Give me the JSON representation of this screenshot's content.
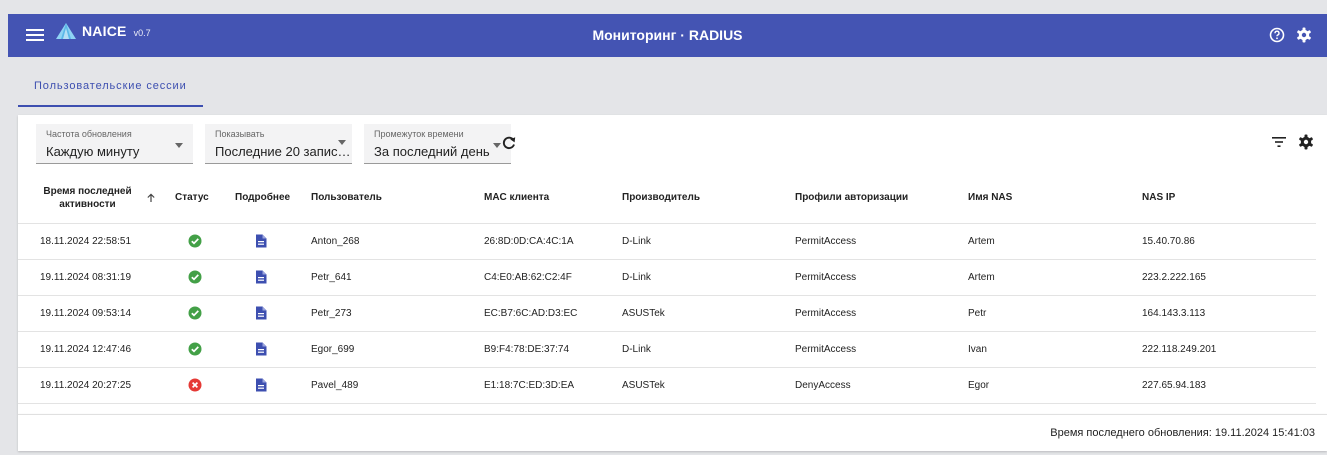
{
  "header": {
    "logo_name": "NAICE",
    "logo_version": "v0.7",
    "title": "Мониторинг · RADIUS",
    "accent_color": "#4454b3"
  },
  "tabs": [
    {
      "label": "Пользовательские сессии",
      "active": true
    }
  ],
  "controls": {
    "refresh_rate": {
      "label": "Частота обновления",
      "value": "Каждую минуту"
    },
    "show": {
      "label": "Показывать",
      "value": "Последние 20 запис…"
    },
    "time_range": {
      "label": "Промежуток времени",
      "value": "За последний день"
    }
  },
  "table": {
    "columns": [
      "Время последней активности",
      "Статус",
      "Подробнее",
      "Пользователь",
      "MAC клиента",
      "Производитель",
      "Профили авторизации",
      "Имя NAS",
      "NAS IP"
    ],
    "sort_column": "Время последней активности",
    "sort_direction": "ascending",
    "rows": [
      {
        "time": "18.11.2024 22:58:51",
        "status": "success",
        "user": "Anton_268",
        "mac": "26:8D:0D:CA:4C:1A",
        "vendor": "D-Link",
        "profile": "PermitAccess",
        "nas_name": "Artem",
        "nas_ip": "15.40.70.86"
      },
      {
        "time": "19.11.2024 08:31:19",
        "status": "success",
        "user": "Petr_641",
        "mac": "C4:E0:AB:62:C2:4F",
        "vendor": "D-Link",
        "profile": "PermitAccess",
        "nas_name": "Artem",
        "nas_ip": "223.2.222.165"
      },
      {
        "time": "19.11.2024 09:53:14",
        "status": "success",
        "user": "Petr_273",
        "mac": "EC:B7:6C:AD:D3:EC",
        "vendor": "ASUSTek",
        "profile": "PermitAccess",
        "nas_name": "Petr",
        "nas_ip": "164.143.3.113"
      },
      {
        "time": "19.11.2024 12:47:46",
        "status": "success",
        "user": "Egor_699",
        "mac": "B9:F4:78:DE:37:74",
        "vendor": "D-Link",
        "profile": "PermitAccess",
        "nas_name": "Ivan",
        "nas_ip": "222.118.249.201"
      },
      {
        "time": "19.11.2024 20:27:25",
        "status": "error",
        "user": "Pavel_489",
        "mac": "E1:18:7C:ED:3D:EA",
        "vendor": "ASUSTek",
        "profile": "DenyAccess",
        "nas_name": "Egor",
        "nas_ip": "227.65.94.183"
      }
    ]
  },
  "status_colors": {
    "success": "#43a047",
    "error": "#e53935"
  },
  "doc_icon_color": "#3d4fb0",
  "footer": {
    "last_updated": "Время последнего обновления: 19.11.2024 15:41:03"
  }
}
